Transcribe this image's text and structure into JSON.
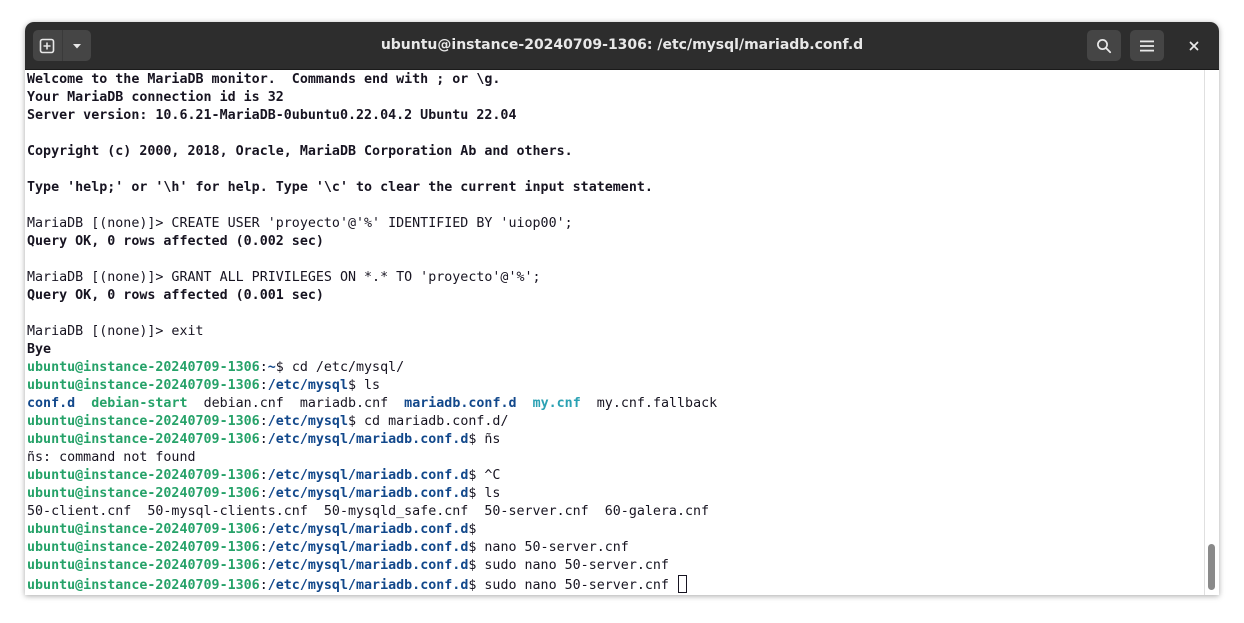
{
  "window": {
    "title": "ubuntu@instance-20240709-1306: /etc/mysql/mariadb.conf.d",
    "new_tab_icon": "new-tab-icon",
    "dropdown_icon": "chevron-down-icon",
    "search_icon": "search-icon",
    "menu_icon": "hamburger-menu-icon",
    "close_icon": "close-icon"
  },
  "colors": {
    "prompt_user": "#26a269",
    "prompt_path": "#12488b",
    "directory": "#12488b",
    "symlink": "#2aa1b3",
    "titlebar": "#2d2d2d",
    "text": "#171421"
  },
  "terminal": {
    "lines": [
      [
        {
          "t": "Welcome to the MariaDB monitor.  Commands end with ; or \\g.",
          "c": "b"
        }
      ],
      [
        {
          "t": "Your MariaDB connection id is 32",
          "c": "b"
        }
      ],
      [
        {
          "t": "Server version: 10.6.21-MariaDB-0ubuntu0.22.04.2 Ubuntu 22.04",
          "c": "b"
        }
      ],
      [],
      [
        {
          "t": "Copyright (c) 2000, 2018, Oracle, MariaDB Corporation Ab and others.",
          "c": "b"
        }
      ],
      [],
      [
        {
          "t": "Type 'help;' or '\\h' for help. Type '\\c' to clear the current input statement.",
          "c": "b"
        }
      ],
      [],
      [
        {
          "t": "MariaDB [(none)]> CREATE USER 'proyecto'@'%' IDENTIFIED BY 'uiop00';"
        }
      ],
      [
        {
          "t": "Query OK, 0 rows affected (0.002 sec)",
          "c": "b"
        }
      ],
      [],
      [
        {
          "t": "MariaDB [(none)]> GRANT ALL PRIVILEGES ON *.* TO 'proyecto'@'%';"
        }
      ],
      [
        {
          "t": "Query OK, 0 rows affected (0.001 sec)",
          "c": "b"
        }
      ],
      [],
      [
        {
          "t": "MariaDB [(none)]> exit"
        }
      ],
      [
        {
          "t": "Bye",
          "c": "b"
        }
      ],
      [
        {
          "t": "ubuntu@instance-20240709-1306",
          "c": "green"
        },
        {
          "t": ":"
        },
        {
          "t": "~",
          "c": "blue"
        },
        {
          "t": "$ cd /etc/mysql/"
        }
      ],
      [
        {
          "t": "ubuntu@instance-20240709-1306",
          "c": "green"
        },
        {
          "t": ":"
        },
        {
          "t": "/etc/mysql",
          "c": "blue"
        },
        {
          "t": "$ ls"
        }
      ],
      [
        {
          "t": "conf.d",
          "c": "blue"
        },
        {
          "t": "  "
        },
        {
          "t": "debian-start",
          "c": "green"
        },
        {
          "t": "  debian.cnf  mariadb.cnf  "
        },
        {
          "t": "mariadb.conf.d",
          "c": "blue"
        },
        {
          "t": "  "
        },
        {
          "t": "my.cnf",
          "c": "cyan"
        },
        {
          "t": "  my.cnf.fallback"
        }
      ],
      [
        {
          "t": "ubuntu@instance-20240709-1306",
          "c": "green"
        },
        {
          "t": ":"
        },
        {
          "t": "/etc/mysql",
          "c": "blue"
        },
        {
          "t": "$ cd mariadb.conf.d/"
        }
      ],
      [
        {
          "t": "ubuntu@instance-20240709-1306",
          "c": "green"
        },
        {
          "t": ":"
        },
        {
          "t": "/etc/mysql/mariadb.conf.d",
          "c": "blue"
        },
        {
          "t": "$ ñs"
        }
      ],
      [
        {
          "t": "ñs: command not found"
        }
      ],
      [
        {
          "t": "ubuntu@instance-20240709-1306",
          "c": "green"
        },
        {
          "t": ":"
        },
        {
          "t": "/etc/mysql/mariadb.conf.d",
          "c": "blue"
        },
        {
          "t": "$ ^C"
        }
      ],
      [
        {
          "t": "ubuntu@instance-20240709-1306",
          "c": "green"
        },
        {
          "t": ":"
        },
        {
          "t": "/etc/mysql/mariadb.conf.d",
          "c": "blue"
        },
        {
          "t": "$ ls"
        }
      ],
      [
        {
          "t": "50-client.cnf  50-mysql-clients.cnf  50-mysqld_safe.cnf  50-server.cnf  60-galera.cnf"
        }
      ],
      [
        {
          "t": "ubuntu@instance-20240709-1306",
          "c": "green"
        },
        {
          "t": ":"
        },
        {
          "t": "/etc/mysql/mariadb.conf.d",
          "c": "blue"
        },
        {
          "t": "$"
        }
      ],
      [
        {
          "t": "ubuntu@instance-20240709-1306",
          "c": "green"
        },
        {
          "t": ":"
        },
        {
          "t": "/etc/mysql/mariadb.conf.d",
          "c": "blue"
        },
        {
          "t": "$ nano 50-server.cnf"
        }
      ],
      [
        {
          "t": "ubuntu@instance-20240709-1306",
          "c": "green"
        },
        {
          "t": ":"
        },
        {
          "t": "/etc/mysql/mariadb.conf.d",
          "c": "blue"
        },
        {
          "t": "$ sudo nano 50-server.cnf"
        }
      ],
      [
        {
          "t": "ubuntu@instance-20240709-1306",
          "c": "green"
        },
        {
          "t": ":"
        },
        {
          "t": "/etc/mysql/mariadb.conf.d",
          "c": "blue"
        },
        {
          "t": "$ sudo nano 50-server.cnf "
        }
      ]
    ]
  }
}
